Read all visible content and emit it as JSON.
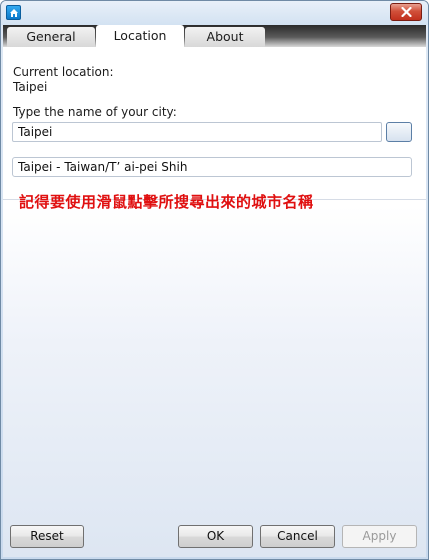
{
  "tabs": [
    {
      "label": "General"
    },
    {
      "label": "Location",
      "active": true
    },
    {
      "label": "About"
    }
  ],
  "location": {
    "current_label": "Current location:",
    "current_value": "Taipei",
    "city_prompt": "Type the name of your city:",
    "city_input_value": "Taipei",
    "result_item": "Taipei - Taiwan/T’  ai-pei Shih"
  },
  "annotation": "記得要使用滑鼠點擊所搜尋出來的城市名稱",
  "buttons": {
    "reset": "Reset",
    "ok": "OK",
    "cancel": "Cancel",
    "apply": "Apply"
  },
  "icons": {
    "app": "home-icon",
    "close": "close-icon"
  },
  "colors": {
    "annotation": "#e01010",
    "close_button": "#c1301d",
    "app_icon": "#1a8ee0"
  }
}
